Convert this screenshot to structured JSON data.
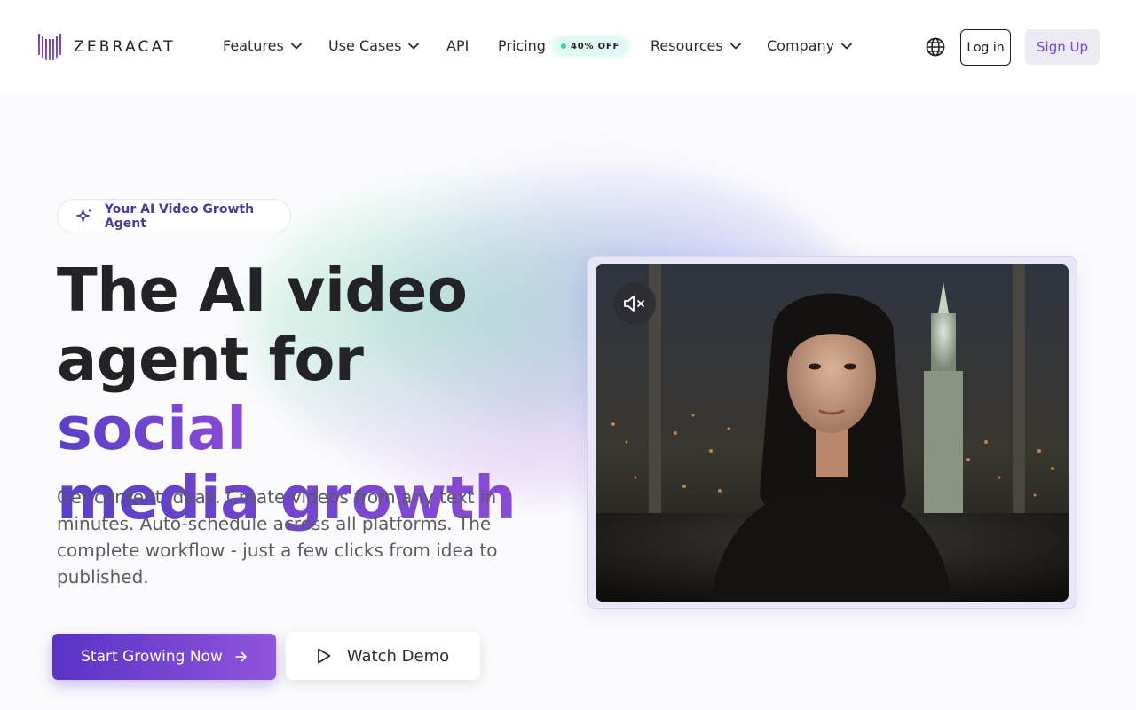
{
  "brand": {
    "name": "ZEBRACAT",
    "accent": "#7b42d8",
    "primary_gradient": [
      "#5a32c6",
      "#8f55dc"
    ]
  },
  "nav": {
    "items": [
      {
        "label": "Features",
        "has_dropdown": true
      },
      {
        "label": "Use Cases",
        "has_dropdown": true
      },
      {
        "label": "API",
        "has_dropdown": false
      },
      {
        "label": "Pricing",
        "has_dropdown": false,
        "badge": "40% OFF"
      },
      {
        "label": "Resources",
        "has_dropdown": true
      },
      {
        "label": "Company",
        "has_dropdown": true
      }
    ],
    "language_icon": "globe-icon",
    "login_label": "Log in",
    "signup_label": "Sign Up"
  },
  "hero": {
    "badge": "Your AI Video Growth Agent",
    "headline_line1": "The AI video",
    "headline_line2_plain": "agent for ",
    "headline_line2_accent": "social",
    "headline_line3_accent": "media growth",
    "subtitle": "Get content ideas. Create videos from any text in minutes. Auto-schedule across all platforms. The complete workflow - just a few clicks from idea to published.",
    "cta_primary": "Start Growing Now",
    "cta_secondary": "Watch Demo"
  },
  "video": {
    "muted": true,
    "mute_icon": "volume-muted-icon"
  }
}
